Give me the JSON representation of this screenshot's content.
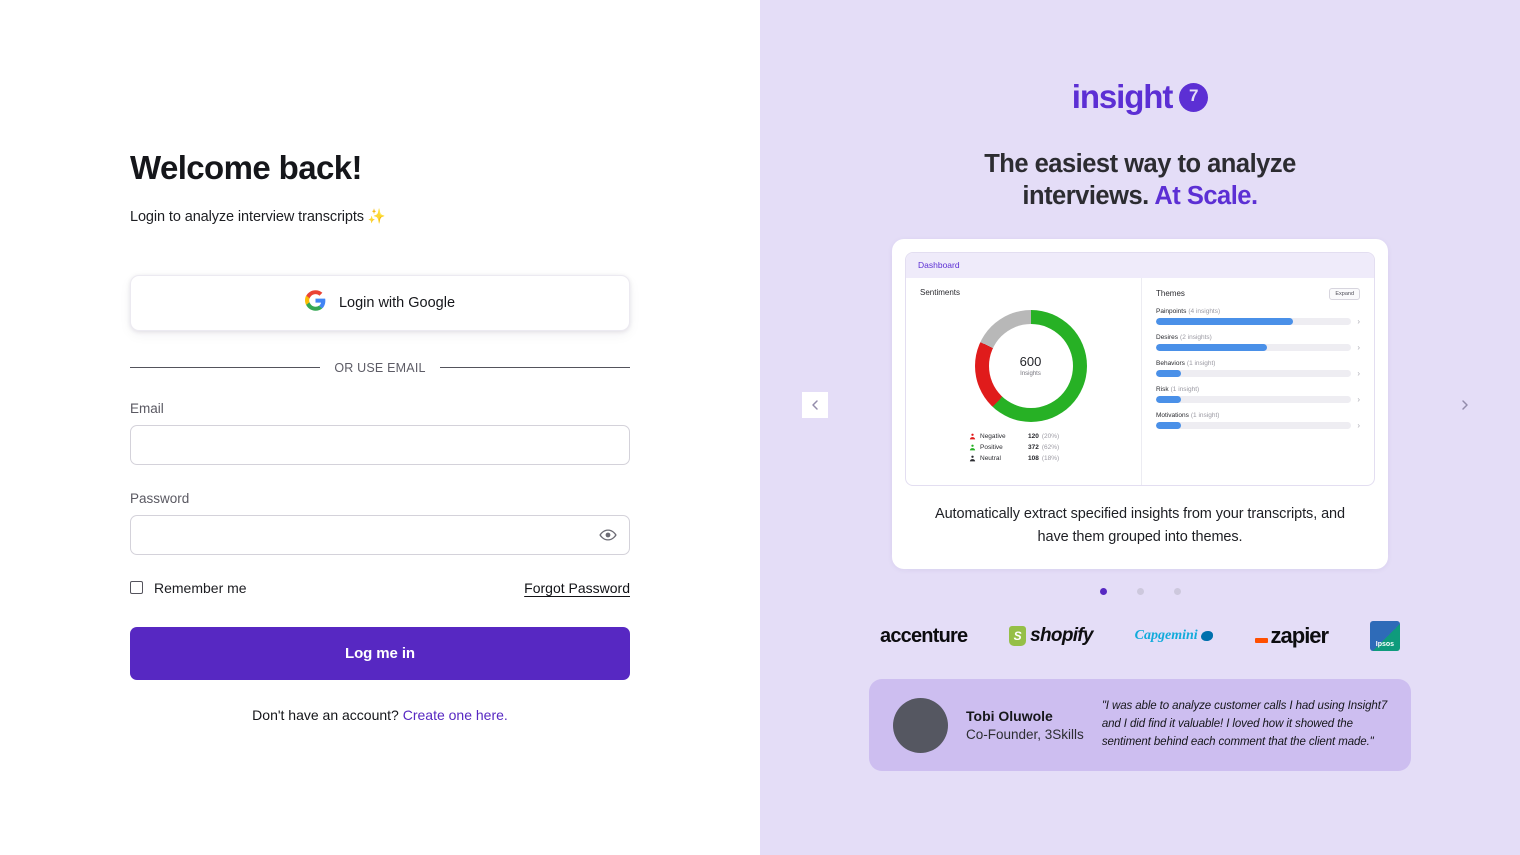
{
  "login": {
    "title": "Welcome back!",
    "subtitle": "Login to analyze interview transcripts ✨",
    "google_button": "Login with Google",
    "google_icon": "google-icon",
    "divider_text": "OR USE EMAIL",
    "email_label": "Email",
    "email_value": "",
    "email_placeholder": "",
    "password_label": "Password",
    "password_value": "",
    "password_placeholder": "",
    "password_toggle_icon": "eye-icon",
    "remember_label": "Remember me",
    "remember_checked": false,
    "forgot_label": "Forgot Password",
    "submit_label": "Log me in",
    "signup_prefix": "Don't have an account? ",
    "signup_link": "Create one here.",
    "accent_color": "#5728c2"
  },
  "marketing": {
    "logo_word": "insight",
    "logo_badge": "7",
    "headline_plain": "The easiest way to analyze interviews. ",
    "headline_accent": "At Scale.",
    "panel_bg": "#e4ddf7",
    "carousel": {
      "prev_icon": "chevron-left-icon",
      "next_icon": "chevron-right-icon",
      "caption": "Automatically extract specified insights from your transcripts, and have them grouped into themes.",
      "dots": 3,
      "active_dot": 0
    },
    "dashboard": {
      "header": "Dashboard",
      "sentiments_title": "Sentiments",
      "themes_title": "Themes",
      "expand_label": "Expand"
    },
    "brands": [
      {
        "name": "accenture",
        "icon": "accenture-logo"
      },
      {
        "name": "shopify",
        "icon": "shopify-logo"
      },
      {
        "name": "Capgemini",
        "icon": "capgemini-logo"
      },
      {
        "name": "zapier",
        "icon": "zapier-logo"
      },
      {
        "name": "Ipsos",
        "icon": "ipsos-logo"
      }
    ],
    "testimonial": {
      "name": "Tobi Oluwole",
      "role": "Co-Founder, 3Skills",
      "quote": "\"I was able to analyze customer calls I had using Insight7 and I did find it valuable! I loved how it showed the sentiment behind each comment that the client made.\""
    }
  },
  "chart_data": [
    {
      "type": "pie",
      "title": "Sentiments",
      "center_value": "600",
      "center_label": "Insights",
      "total": 600,
      "categories": [
        "Negative",
        "Positive",
        "Neutral"
      ],
      "values": [
        120,
        372,
        108
      ],
      "percents": [
        "20%",
        "62%",
        "18%"
      ],
      "value_labels": [
        "120",
        "372",
        "108"
      ],
      "colors": [
        "#e01b1b",
        "#27b125",
        "#b8b8b8"
      ],
      "legend": "bottom",
      "grid": false
    },
    {
      "type": "bar",
      "title": "Themes",
      "orientation": "horizontal",
      "categories": [
        "Painpoints",
        "Desires",
        "Behaviors",
        "Risk",
        "Motivations"
      ],
      "count_labels": [
        "(4 insights)",
        "(2 insights)",
        "(1 insight)",
        "(1 insight)",
        "(1 insight)"
      ],
      "values": [
        4,
        2,
        1,
        1,
        1
      ],
      "bar_percents": [
        70,
        57,
        13,
        13,
        13
      ],
      "bar_color": "#4a90e8",
      "track_color": "#eeedf2",
      "xlabel": "",
      "ylabel": "",
      "grid": false
    }
  ]
}
